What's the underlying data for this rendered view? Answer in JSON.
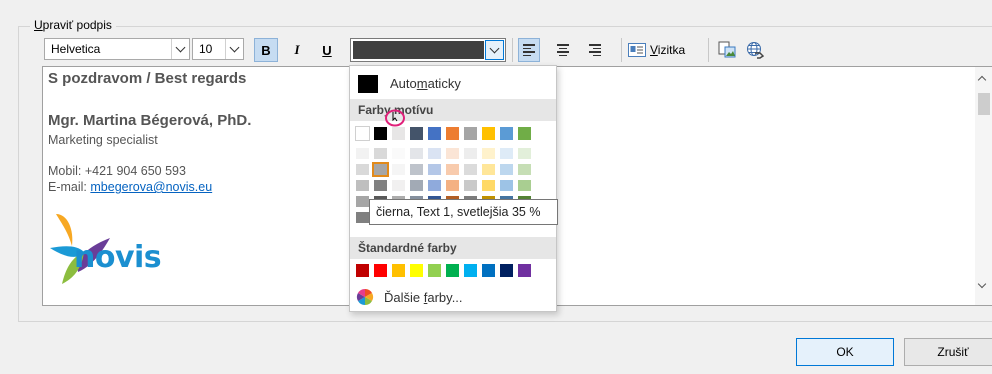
{
  "group": {
    "label_prefix": "U",
    "label_rest": "praviť podpis"
  },
  "toolbar": {
    "font": "Helvetica",
    "size": "10",
    "bold": "B",
    "italic": "I",
    "underline": "U",
    "font_color": "#404040",
    "vizitka_prefix": "V",
    "vizitka_rest": "izitka"
  },
  "signature": {
    "greeting": "S pozdravom / Best regards",
    "name": "Mgr. Martina Bégerová, PhD.",
    "role": "Marketing specialist",
    "mobile": "Mobil: +421 904 650 593",
    "email_label": "E-mail: ",
    "email": "mbegerova@novis.eu",
    "logo_text": "novis"
  },
  "color_menu": {
    "automatic_pre": "Auto",
    "automatic_ul": "m",
    "automatic_post": "aticky",
    "theme_header": "Farby motívu",
    "standard_header": "Štandardné farby",
    "more_pre": "Ďalšie ",
    "more_ul": "f",
    "more_post": "arby...",
    "theme_colors": [
      "#ffffff",
      "#000000",
      "#e7e6e6",
      "#44546a",
      "#4472c4",
      "#ed7d31",
      "#a5a5a5",
      "#ffc000",
      "#5b9bd5",
      "#70ad47"
    ],
    "standard_colors": [
      "#c00000",
      "#ff0000",
      "#ffc000",
      "#ffff00",
      "#92d050",
      "#00b050",
      "#00b0f0",
      "#0070c0",
      "#002060",
      "#7030a0"
    ]
  },
  "tooltip": "čierna, Text 1, svetlejšia 35 %",
  "buttons": {
    "ok": "OK",
    "cancel": "Zrušiť"
  }
}
